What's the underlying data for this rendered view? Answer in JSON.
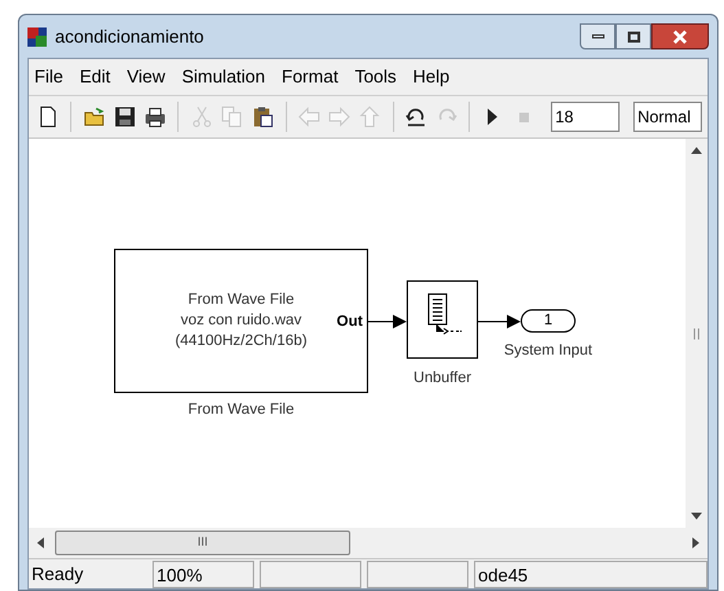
{
  "window": {
    "title": "acondicionamiento"
  },
  "menu": [
    "File",
    "Edit",
    "View",
    "Simulation",
    "Format",
    "Tools",
    "Help"
  ],
  "toolbar": [
    {
      "kind": "new",
      "disabled": false
    },
    {
      "kind": "sep"
    },
    {
      "kind": "open",
      "disabled": false
    },
    {
      "kind": "save",
      "disabled": false
    },
    {
      "kind": "print",
      "disabled": false
    },
    {
      "kind": "sep"
    },
    {
      "kind": "cut",
      "disabled": true
    },
    {
      "kind": "copy",
      "disabled": true
    },
    {
      "kind": "paste",
      "disabled": false
    },
    {
      "kind": "sep"
    },
    {
      "kind": "back",
      "disabled": true
    },
    {
      "kind": "forward",
      "disabled": true
    },
    {
      "kind": "up",
      "disabled": true
    },
    {
      "kind": "sep"
    },
    {
      "kind": "undo",
      "disabled": false
    },
    {
      "kind": "redo",
      "disabled": true
    },
    {
      "kind": "sep"
    },
    {
      "kind": "play",
      "disabled": false
    },
    {
      "kind": "stop",
      "disabled": true
    }
  ],
  "stop_time": {
    "value": "18"
  },
  "sim_mode": {
    "value": "Normal"
  },
  "blocks": [
    {
      "kind": "source",
      "lines": [
        "From Wave File",
        "voz con ruido.wav",
        "(44100Hz/2Ch/16b)"
      ],
      "port": "Out",
      "name": "From Wave File"
    },
    {
      "kind": "unbuffer",
      "name": "Unbuffer"
    },
    {
      "kind": "outport",
      "number": "1",
      "name": "System Input"
    }
  ],
  "scrollbar": {
    "thumb": "III"
  },
  "status_bar": {
    "message": "Ready",
    "zoom": "100%",
    "solver": "ode45"
  }
}
